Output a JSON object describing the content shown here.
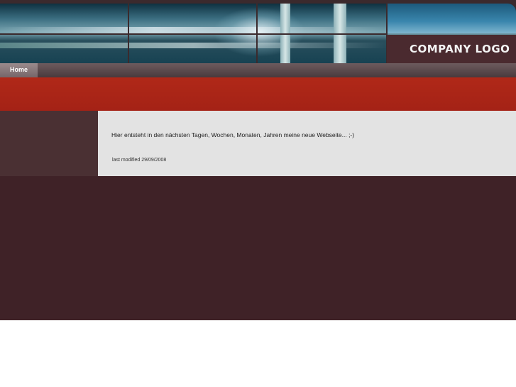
{
  "header": {
    "logo_text": "COMPANY LOGO"
  },
  "nav": {
    "items": [
      {
        "label": "Home"
      }
    ]
  },
  "content": {
    "message": "Hier entsteht in den nächsten Tagen, Wochen, Monaten, Jahren meine neue Webseite... ;-)",
    "last_modified": "last modified 29/09/2008"
  },
  "colors": {
    "page_background": "#3f2227",
    "red_band": "#b02818",
    "content_box": "#e3e3e3"
  }
}
